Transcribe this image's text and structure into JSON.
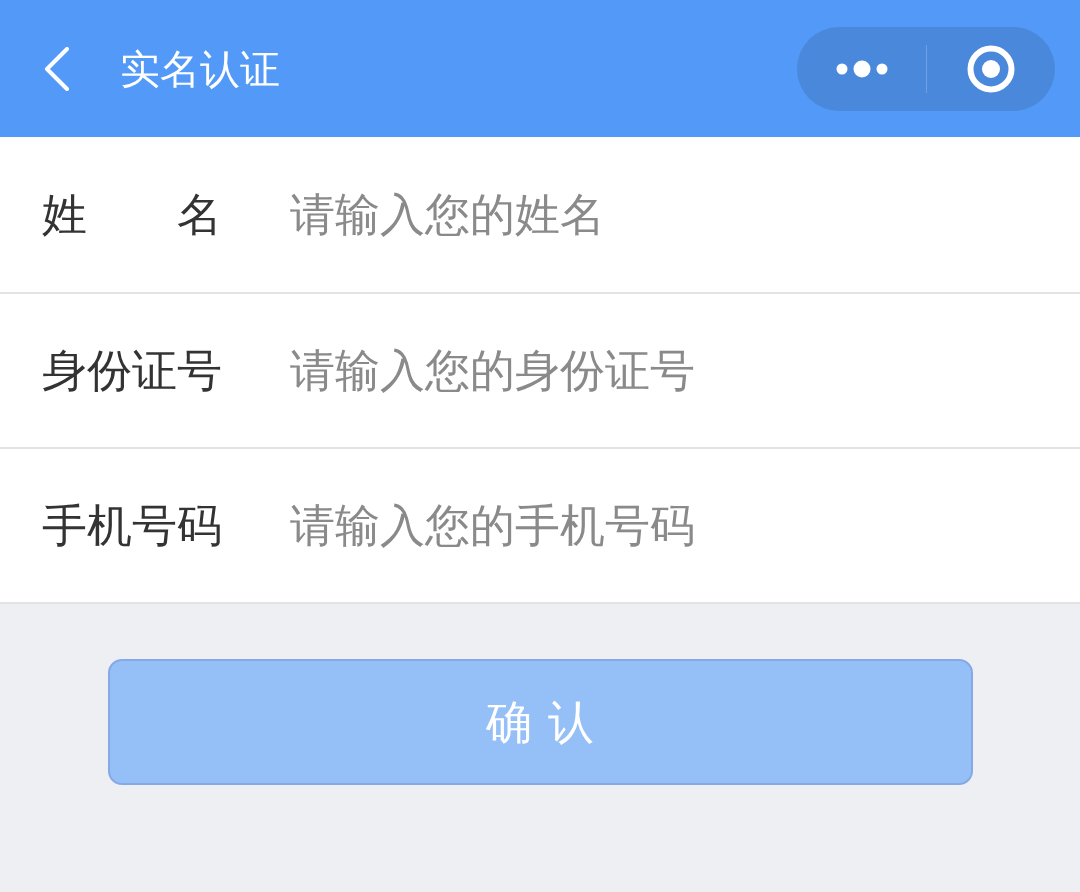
{
  "header": {
    "title": "实名认证"
  },
  "form": {
    "fields": [
      {
        "label": "姓　　名",
        "placeholder": "请输入您的姓名"
      },
      {
        "label": "身份证号",
        "placeholder": "请输入您的身份证号"
      },
      {
        "label": "手机号码",
        "placeholder": "请输入您的手机号码"
      }
    ]
  },
  "confirm_button": {
    "label": "确认",
    "disabled": true
  }
}
